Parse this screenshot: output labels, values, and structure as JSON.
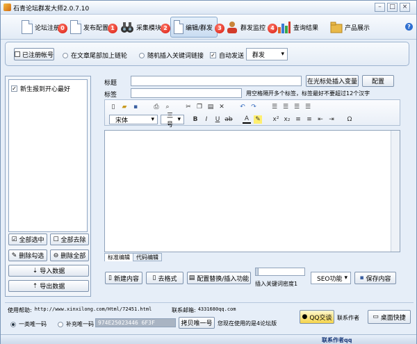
{
  "window": {
    "title": "石青论坛群发大师2.0.7.10"
  },
  "toolbar": {
    "items": [
      {
        "label": "论坛注册",
        "badge": "0"
      },
      {
        "label": "发布配置",
        "badge": "1"
      },
      {
        "label": "采集模块",
        "badge": "2"
      },
      {
        "label": "编辑/群发",
        "badge": "3"
      },
      {
        "label": "群发监控",
        "badge": "4"
      },
      {
        "label": "查询结果",
        "badge": ""
      },
      {
        "label": "产品展示",
        "badge": ""
      }
    ],
    "active": "编辑/群发",
    "help": "?"
  },
  "options": {
    "registered_btn": "已注册帐号",
    "opt1": "在文章尾部加上链轮",
    "opt2": "随机插入关键词链接",
    "opt3": "自动发送",
    "mode_value": "群发"
  },
  "left": {
    "list": [
      {
        "label": "新生报到开心最好",
        "checked": true
      }
    ],
    "btn_select_all": "全部选中",
    "btn_remove_all": "全部去除",
    "btn_delete_checked": "删除勾选",
    "btn_delete_all": "删除全部",
    "btn_import": "导入数据",
    "btn_export": "导出数据"
  },
  "form": {
    "title_label": "标题",
    "tags_label": "标签",
    "insert_var_btn": "在光标处插入变量",
    "config_btn": "配置",
    "tags_hint": "用空格隔开多个标签，标签最好不要超过12个汉字"
  },
  "editor": {
    "font": "宋体",
    "size": "三号",
    "tab_standard": "标准编辑",
    "tab_code": "代码编辑"
  },
  "actions": {
    "new_btn": "新建内容",
    "format_btn": "去格式",
    "replace_btn": "配置替换/插入功能",
    "density_label": "插入关键词密度1",
    "seo_value": "SEO功能",
    "save_btn": "保存内容"
  },
  "status": {
    "help_label": "使用帮助:",
    "help_url": "http://www.xinxilong.com/Html/72451.html",
    "email_label": "联系邮箱:",
    "email": "4331680qq.com",
    "radio1": "一类唯一码",
    "radio2": "补充唯一码",
    "code": "974E25023446 6F3F",
    "copy_btn": "拷贝唯一号",
    "forum_count": "您现在使用的是4论坛版",
    "qq_btn": "QQ交谈",
    "contact_btn": "联系作者",
    "desktop_btn": "桌面快捷"
  },
  "footer": {
    "text": "联系作者qq"
  },
  "colors": {
    "accent": "#2f6fd0",
    "badge": "#d7150a"
  }
}
